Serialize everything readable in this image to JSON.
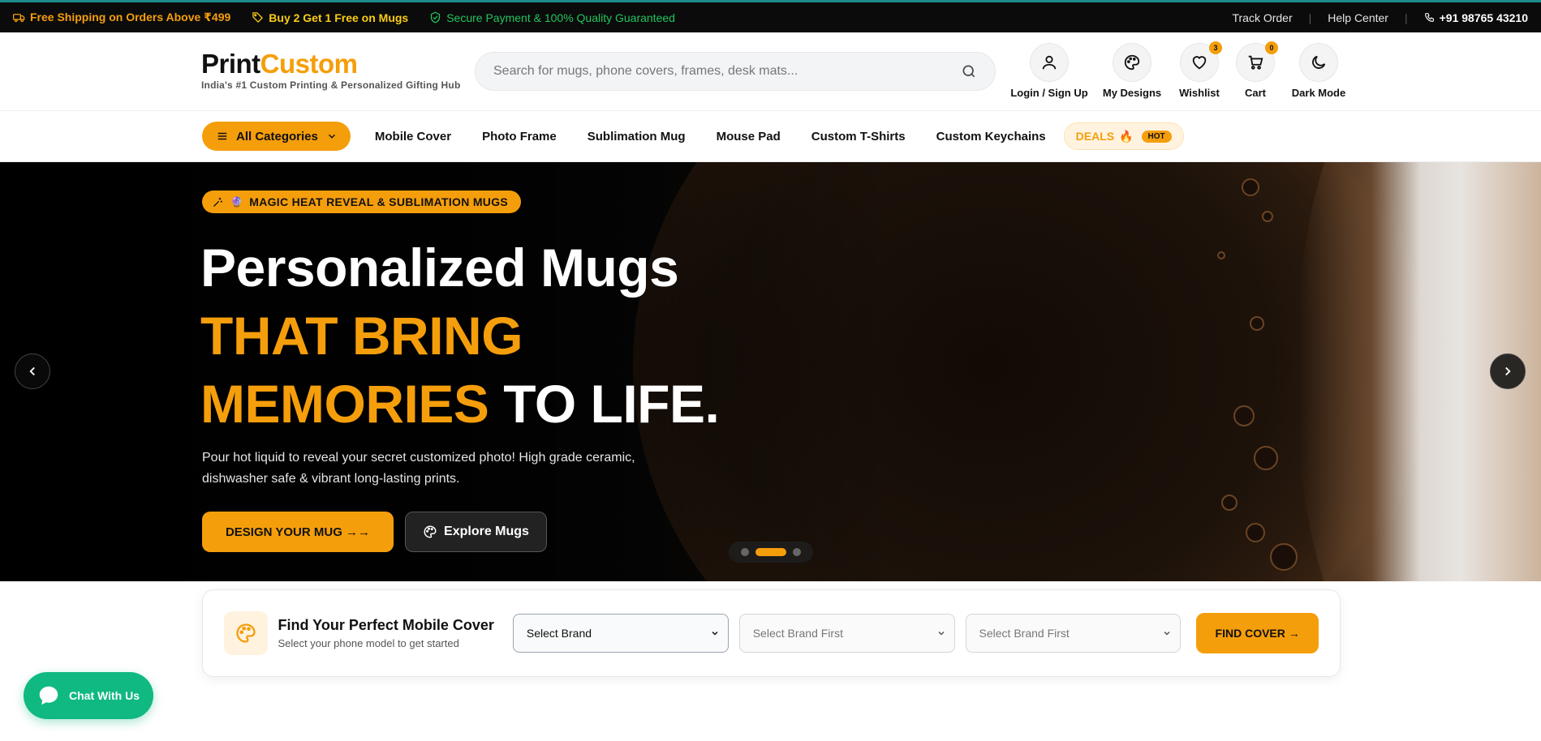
{
  "topbar": {
    "promos": [
      {
        "text": "Free Shipping on Orders Above ₹499",
        "icon": "truck-icon",
        "color": "#f59e0b"
      },
      {
        "text": "Buy 2 Get 1 Free on Mugs",
        "icon": "tag-icon",
        "color": "#facc15"
      },
      {
        "text": "Secure Payment & 100% Quality Guaranteed",
        "icon": "shield-check-icon",
        "color": "#22c55e"
      }
    ],
    "links": [
      "Track Order",
      "Help Center"
    ],
    "phone": "+91 98765 43210"
  },
  "header": {
    "logo_part1": "Print",
    "logo_part2": "Custom",
    "tagline": "India's #1 Custom Printing & Personalized Gifting Hub",
    "search_placeholder": "Search for mugs, phone covers, frames, desk mats...",
    "icons": [
      {
        "label": "Login / Sign Up",
        "icon": "user-icon"
      },
      {
        "label": "My Designs",
        "icon": "palette-icon"
      },
      {
        "label": "Wishlist",
        "icon": "heart-icon",
        "badge": "3"
      },
      {
        "label": "Cart",
        "icon": "cart-icon",
        "badge": "0"
      },
      {
        "label": "Dark Mode",
        "icon": "moon-icon"
      }
    ]
  },
  "nav": {
    "all_categories": "All Categories",
    "links": [
      "Mobile Cover",
      "Photo Frame",
      "Sublimation Mug",
      "Mouse Pad",
      "Custom T-Shirts",
      "Custom Keychains"
    ],
    "deals_label": "DEALS",
    "deals_emoji": "🔥",
    "deals_badge": "HOT"
  },
  "hero": {
    "badge": "MAGIC HEAT REVEAL & SUBLIMATION MUGS",
    "title_line1": "Personalized Mugs",
    "title_line2": "THAT BRING",
    "title_line3_accent": "MEMORIES",
    "title_line3_rest": "TO LIFE.",
    "subtitle": "Pour hot liquid to reveal your secret customized photo! High grade ceramic, dishwasher safe & vibrant long-lasting prints.",
    "primary_button": "DESIGN YOUR MUG →→",
    "secondary_button": "Explore Mugs",
    "slides_total": 3,
    "active_slide": 2,
    "accent_color": "#f59e0b"
  },
  "finder": {
    "title": "Find Your Perfect Mobile Cover",
    "subtitle": "Select your phone model to get started",
    "brand_select": "Select Brand",
    "model_select": "Select Brand First",
    "variant_select": "Select Brand First",
    "button": "FIND COVER →"
  },
  "chat": {
    "label": "Chat With Us",
    "color": "#10b981"
  }
}
